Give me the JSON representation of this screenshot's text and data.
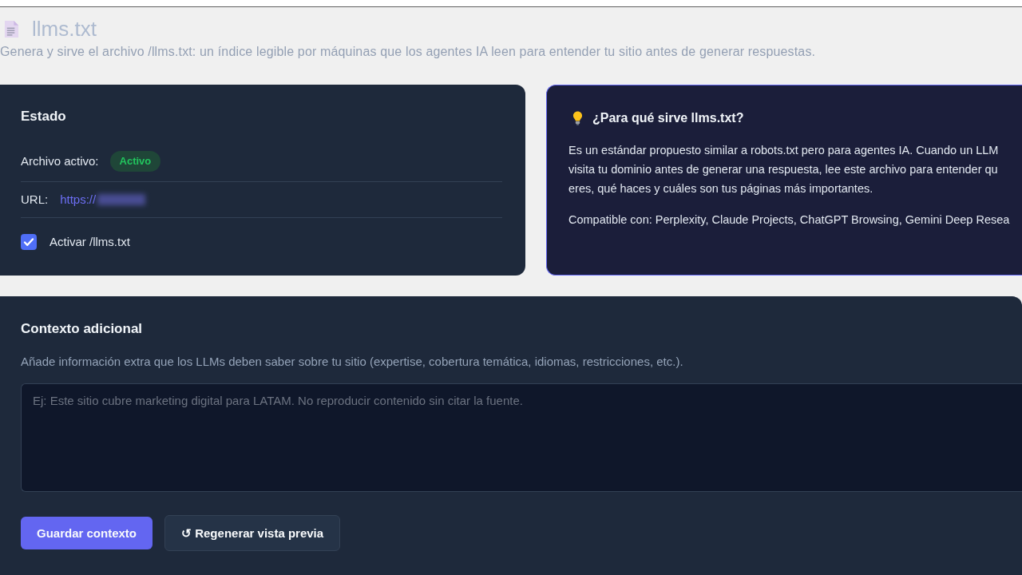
{
  "header": {
    "title": "llms.txt",
    "subtitle": "Genera y sirve el archivo /llms.txt: un índice legible por máquinas que los agentes IA leen para entender tu sitio antes de generar respuestas."
  },
  "status_card": {
    "title": "Estado",
    "file_label": "Archivo activo:",
    "file_badge": "Activo",
    "url_label": "URL:",
    "url_value": "https://",
    "toggle": {
      "label": "Activar /llms.txt",
      "checked": true
    }
  },
  "info_card": {
    "title": "¿Para qué sirve llms.txt?",
    "body_lines": [
      "Es un estándar propuesto similar a robots.txt pero para agentes IA. Cuando un LLM",
      "visita tu dominio antes de generar una respuesta, lee este archivo para entender qu",
      "eres, qué haces y cuáles son tus páginas más importantes."
    ],
    "compatible": "Compatible con: Perplexity, Claude Projects, ChatGPT Browsing, Gemini Deep Resea"
  },
  "context_card": {
    "title": "Contexto adicional",
    "description": "Añade información extra que los LLMs deben saber sobre tu sitio (expertise, cobertura temática, idiomas, restricciones, etc.).",
    "textarea": {
      "placeholder": "Ej: Este sitio cubre marketing digital para LATAM. No reproducir contenido sin citar la fuente."
    },
    "buttons": [
      {
        "label": "Guardar contexto",
        "kind": "primary"
      },
      {
        "label": "↺ Regenerar vista previa",
        "kind": "secondary"
      }
    ]
  }
}
